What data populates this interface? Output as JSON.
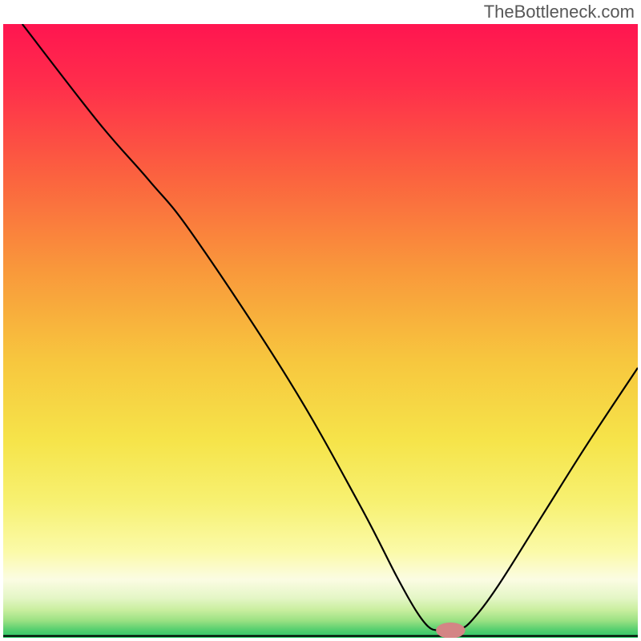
{
  "watermark": "TheBottleneck.com",
  "chart_data": {
    "type": "line",
    "title": "",
    "xlabel": "",
    "ylabel": "",
    "xlim": [
      0,
      100
    ],
    "ylim": [
      0,
      100
    ],
    "gradient_stops": [
      {
        "offset": 0.0,
        "color": "#ff1550"
      },
      {
        "offset": 0.1,
        "color": "#ff2e4b"
      },
      {
        "offset": 0.25,
        "color": "#fb633f"
      },
      {
        "offset": 0.4,
        "color": "#f9983b"
      },
      {
        "offset": 0.55,
        "color": "#f7c73e"
      },
      {
        "offset": 0.68,
        "color": "#f6e44a"
      },
      {
        "offset": 0.78,
        "color": "#f7f172"
      },
      {
        "offset": 0.86,
        "color": "#fbfaa8"
      },
      {
        "offset": 0.905,
        "color": "#fbfce3"
      },
      {
        "offset": 0.935,
        "color": "#e4f6c6"
      },
      {
        "offset": 0.955,
        "color": "#c8ee9e"
      },
      {
        "offset": 0.972,
        "color": "#9be183"
      },
      {
        "offset": 0.986,
        "color": "#5ad070"
      },
      {
        "offset": 1.0,
        "color": "#28c667"
      }
    ],
    "line_points": [
      [
        3,
        100
      ],
      [
        15,
        84
      ],
      [
        23,
        74.5
      ],
      [
        30,
        65.5
      ],
      [
        45,
        42
      ],
      [
        56,
        22
      ],
      [
        62,
        10
      ],
      [
        65,
        4.5
      ],
      [
        67,
        1.8
      ],
      [
        68.5,
        1.2
      ],
      [
        70,
        1.2
      ],
      [
        72,
        1.4
      ],
      [
        74,
        3
      ],
      [
        78,
        8.5
      ],
      [
        85,
        20
      ],
      [
        92,
        31.5
      ],
      [
        100,
        44
      ]
    ],
    "marker": {
      "x": 70.5,
      "y": 1.2,
      "color": "#d48585",
      "rx": 2.3,
      "ry": 1.3
    },
    "baseline_y": 0.3
  }
}
